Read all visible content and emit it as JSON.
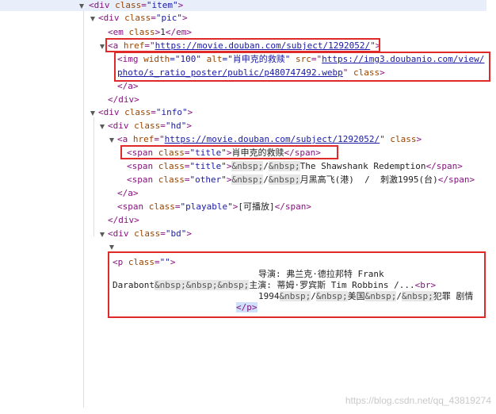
{
  "tree": {
    "item_div": {
      "open": "<div",
      "attr": "class",
      "eq": "=",
      "val": "\"item\"",
      "close": ">"
    },
    "pic_div": {
      "open": "<div",
      "attr": "class",
      "eq": "=",
      "val": "\"pic\"",
      "close": ">"
    },
    "em": {
      "open": "<em",
      "attr": "class",
      "close": ">",
      "text": "1",
      "end": "</em>"
    },
    "pic_link": {
      "open": "<a",
      "attr": "href",
      "eq": "=\"",
      "url": "https://movie.douban.com/subject/1292052/",
      "q": "\"",
      "close": ">"
    },
    "img": {
      "open": "<img",
      "attr_width": "width",
      "width_val": "=\"100\"",
      "attr_alt": "alt",
      "alt_val": "=\"肖申克的救赎\"",
      "attr_src": "src",
      "src_eq": "=\"",
      "src_url_line1": "https://img3.doubanio.com/view/",
      "src_url_line2": "photo/s_ratio_poster/public/p480747492.webp",
      "src_q": "\"",
      "attr_class": "class",
      "close": ">"
    },
    "a_end": "</a>",
    "div_end": "</div>",
    "info_div": {
      "open": "<div",
      "attr": "class",
      "eq": "=",
      "val": "\"info\"",
      "close": ">"
    },
    "hd_div": {
      "open": "<div",
      "attr": "class",
      "eq": "=",
      "val": "\"hd\"",
      "close": ">"
    },
    "hd_link": {
      "open": "<a",
      "attr": "href",
      "eq": "=\"",
      "url": "https://movie.douban.com/subject/1292052/",
      "q": "\"",
      "attr2": "class",
      "close": ">"
    },
    "span_title1": {
      "open": "<span",
      "attr": "class",
      "eq": "=",
      "val": "\"title\"",
      "close": ">",
      "text": "肖申克的救赎",
      "end": "</span>"
    },
    "span_title2": {
      "open": "<span",
      "attr": "class",
      "eq": "=",
      "val": "\"title\"",
      "close": ">",
      "ent1": "&nbsp;",
      "mid": "/",
      "ent2": "&nbsp;",
      "text": "The Shawshank Redemption",
      "end": "</span>"
    },
    "span_other": {
      "open": "<span",
      "attr": "class",
      "eq": "=",
      "val": "\"other\"",
      "close": ">",
      "ent1": "&nbsp;",
      "mid": "/",
      "ent2": "&nbsp;",
      "text": "月黑高飞(港)  /  刺激1995(台)",
      "end": "</span>"
    },
    "a_close": "</a>",
    "span_playable": {
      "open": "<span",
      "attr": "class",
      "eq": "=",
      "val": "\"playable\"",
      "close": ">",
      "text": "[可播放]",
      "end": "</span>"
    },
    "div_close": "</div>",
    "bd_div": {
      "open": "<div",
      "attr": "class",
      "eq": "=",
      "val": "\"bd\"",
      "close": ">"
    },
    "p_open": {
      "open": "<p",
      "attr": "class",
      "eq": "=",
      "val": "\"\"",
      "close": ">"
    },
    "p_line1": "导演: 弗兰克·德拉邦特 Frank",
    "p_line2_a": "Darabont",
    "p_line2_ents": "&nbsp;&nbsp;&nbsp;",
    "p_line2_b": "主演: 蒂姆·罗宾斯 Tim Robbins /...",
    "br": "<br>",
    "p_line3_year": "1994",
    "p_line3_e1": "&nbsp;",
    "p_line3_s1": "/",
    "p_line3_e2": "&nbsp;",
    "p_line3_country": "美国",
    "p_line3_e3": "&nbsp;",
    "p_line3_s2": "/",
    "p_line3_e4": "&nbsp;",
    "p_line3_genre": "犯罪 剧情",
    "p_end": "</p>"
  },
  "watermark": "https://blog.csdn.net/qq_43819274",
  "colors": {
    "tag": "#881280",
    "attr": "#994500",
    "value": "#1a1aa6",
    "highlight_box": "#e02a2a",
    "selection": "#cfe0fb"
  }
}
